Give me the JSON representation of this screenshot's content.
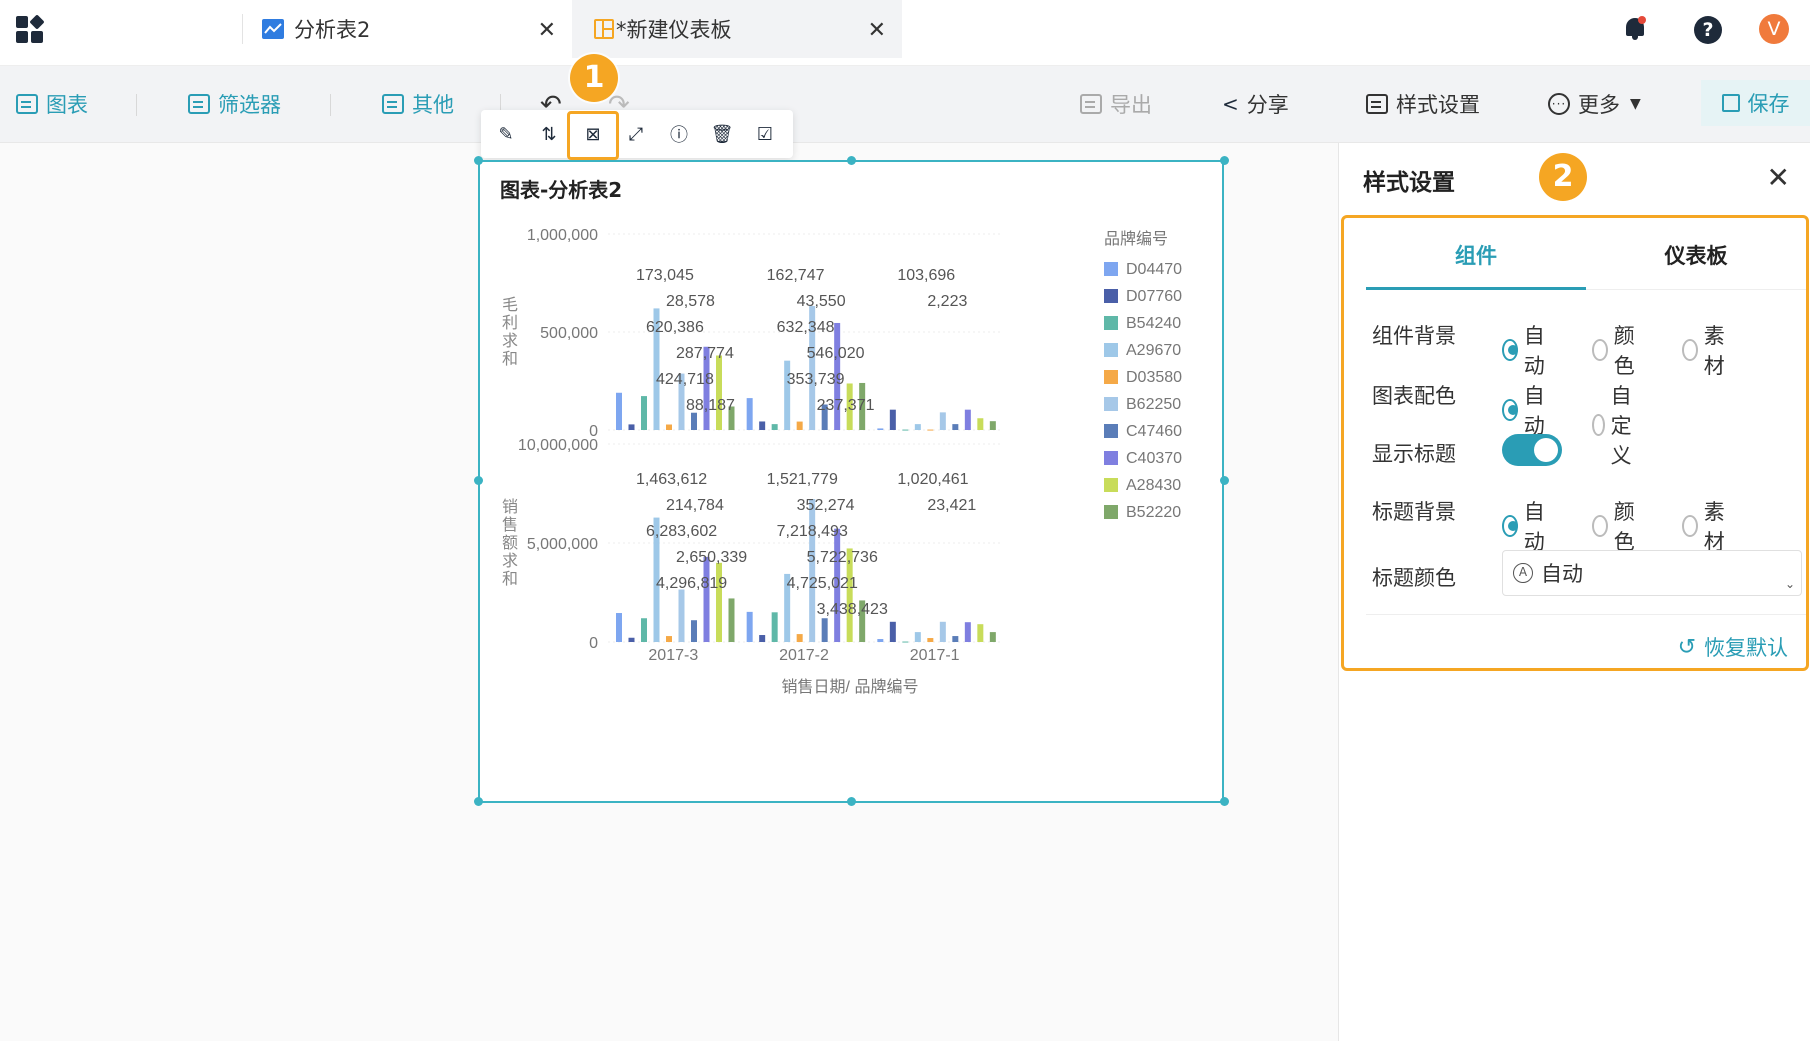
{
  "tabs": [
    {
      "label": "分析表2"
    },
    {
      "label": "*新建仪表板"
    }
  ],
  "avatar_letter": "V",
  "toolbar": {
    "chart_label": "图表",
    "filter_label": "筛选器",
    "other_label": "其他",
    "export_label": "导出",
    "share_label": "分享",
    "style_label": "样式设置",
    "more_label": "更多",
    "save_label": "保存"
  },
  "markers": {
    "one": "1",
    "two": "2"
  },
  "widget": {
    "title": "图表-分析表2",
    "legend_title": "品牌编号",
    "xlabel": "销售日期/ 品牌编号",
    "ylabel_top": "毛利求和",
    "ylabel_bottom": "销售额求和"
  },
  "chart_data": {
    "type": "bar",
    "categories": [
      "2017-3",
      "2017-2",
      "2017-1"
    ],
    "legend": [
      "D04470",
      "D07760",
      "B54240",
      "A29670",
      "D03580",
      "B62250",
      "C47460",
      "C40370",
      "A28430",
      "B52220"
    ],
    "colors": [
      "#7ea6f0",
      "#4a5fa8",
      "#5fb8a8",
      "#9ec8e8",
      "#f5a947",
      "#a6c8e8",
      "#5a7db8",
      "#7f7fe0",
      "#c8dc5a",
      "#7fa86a"
    ],
    "panels": [
      {
        "ylabel": "毛利求和",
        "yticks": [
          "0",
          "500,000",
          "1,000,000"
        ],
        "ylim": [
          0,
          1000000
        ],
        "labels": [
          [
            "173,045",
            "28,578",
            "620,386",
            "287,774",
            "424,718",
            "88,187"
          ],
          [
            "162,747",
            "43,550",
            "632,348",
            "546,020",
            "353,739",
            "237,371"
          ],
          [
            "103,696",
            "2,223"
          ]
        ]
      },
      {
        "ylabel": "销售额求和",
        "yticks": [
          "0",
          "5,000,000",
          "10,000,000"
        ],
        "ylim": [
          0,
          10000000
        ],
        "labels": [
          [
            "1,463,612",
            "214,784",
            "6,283,602",
            "2,650,339",
            "4,296,819"
          ],
          [
            "1,521,779",
            "352,274",
            "7,218,493",
            "5,722,736",
            "4,725,021",
            "3,438,423"
          ],
          [
            "1,020,461",
            "23,421"
          ]
        ]
      }
    ],
    "series_profit": [
      [
        190000,
        28578,
        173045,
        620386,
        28000,
        287774,
        88187,
        424718,
        380000,
        120000
      ],
      [
        162747,
        43550,
        30000,
        353739,
        43000,
        632348,
        130000,
        546020,
        237371,
        240000
      ],
      [
        8000,
        103696,
        2223,
        30000,
        2223,
        90000,
        30000,
        103696,
        60000,
        45000
      ]
    ],
    "series_sales": [
      [
        1463612,
        214784,
        1200000,
        6283602,
        300000,
        2650339,
        1100000,
        4296819,
        4000000,
        2200000
      ],
      [
        1521779,
        352274,
        1500000,
        3438423,
        400000,
        7218493,
        1200000,
        5722736,
        4725021,
        2100000
      ],
      [
        150000,
        1020461,
        23421,
        500000,
        200000,
        1020461,
        300000,
        1000000,
        900000,
        500000
      ]
    ]
  },
  "panel": {
    "title": "样式设置",
    "tab_component": "组件",
    "tab_dashboard": "仪表板",
    "rows": {
      "bg_label": "组件背景",
      "color_label": "图表配色",
      "show_title_label": "显示标题",
      "title_bg_label": "标题背景",
      "title_color_label": "标题颜色"
    },
    "options": {
      "auto": "自动",
      "color": "颜色",
      "material": "素材",
      "custom": "自定义"
    },
    "title_color_value": "自动",
    "restore_label": "恢复默认"
  }
}
